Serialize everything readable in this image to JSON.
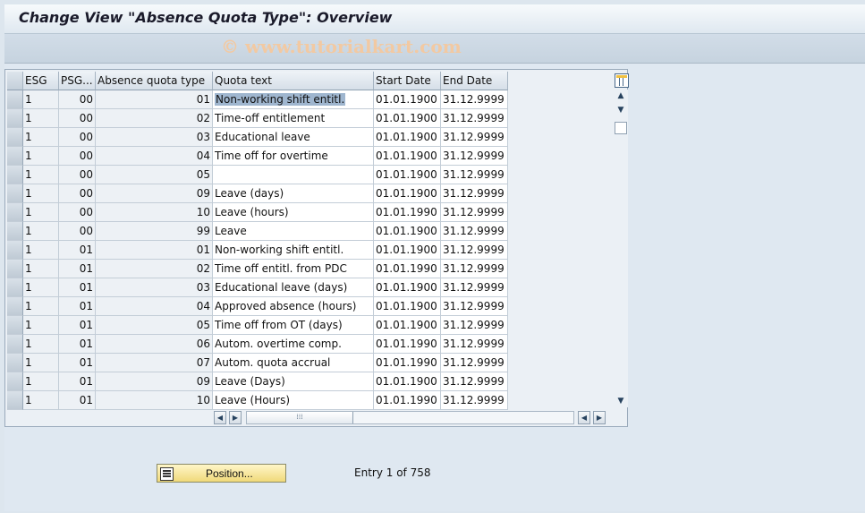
{
  "title": "Change View \"Absence Quota Type\": Overview",
  "watermark": "© www.tutorialkart.com",
  "table": {
    "columns": [
      "ESG",
      "PSG...",
      "Absence quota type",
      "Quota text",
      "Start Date",
      "End Date"
    ],
    "rows": [
      {
        "esg": "1",
        "psg": "00",
        "aqt": "01",
        "qt": "Non-working shift entitl.",
        "sd": "01.01.1900",
        "ed": "31.12.9999"
      },
      {
        "esg": "1",
        "psg": "00",
        "aqt": "02",
        "qt": "Time-off entitlement",
        "sd": "01.01.1900",
        "ed": "31.12.9999"
      },
      {
        "esg": "1",
        "psg": "00",
        "aqt": "03",
        "qt": "Educational leave",
        "sd": "01.01.1900",
        "ed": "31.12.9999"
      },
      {
        "esg": "1",
        "psg": "00",
        "aqt": "04",
        "qt": "Time off for overtime",
        "sd": "01.01.1900",
        "ed": "31.12.9999"
      },
      {
        "esg": "1",
        "psg": "00",
        "aqt": "05",
        "qt": "",
        "sd": "01.01.1900",
        "ed": "31.12.9999"
      },
      {
        "esg": "1",
        "psg": "00",
        "aqt": "09",
        "qt": "Leave (days)",
        "sd": "01.01.1900",
        "ed": "31.12.9999"
      },
      {
        "esg": "1",
        "psg": "00",
        "aqt": "10",
        "qt": "Leave (hours)",
        "sd": "01.01.1990",
        "ed": "31.12.9999"
      },
      {
        "esg": "1",
        "psg": "00",
        "aqt": "99",
        "qt": "Leave",
        "sd": "01.01.1900",
        "ed": "31.12.9999"
      },
      {
        "esg": "1",
        "psg": "01",
        "aqt": "01",
        "qt": "Non-working shift entitl.",
        "sd": "01.01.1900",
        "ed": "31.12.9999"
      },
      {
        "esg": "1",
        "psg": "01",
        "aqt": "02",
        "qt": "Time off entitl. from PDC",
        "sd": "01.01.1990",
        "ed": "31.12.9999"
      },
      {
        "esg": "1",
        "psg": "01",
        "aqt": "03",
        "qt": "Educational leave (days)",
        "sd": "01.01.1900",
        "ed": "31.12.9999"
      },
      {
        "esg": "1",
        "psg": "01",
        "aqt": "04",
        "qt": "Approved absence (hours)",
        "sd": "01.01.1900",
        "ed": "31.12.9999"
      },
      {
        "esg": "1",
        "psg": "01",
        "aqt": "05",
        "qt": "Time off from OT (days)",
        "sd": "01.01.1900",
        "ed": "31.12.9999"
      },
      {
        "esg": "1",
        "psg": "01",
        "aqt": "06",
        "qt": "Autom. overtime comp.",
        "sd": "01.01.1990",
        "ed": "31.12.9999"
      },
      {
        "esg": "1",
        "psg": "01",
        "aqt": "07",
        "qt": "Autom. quota accrual",
        "sd": "01.01.1990",
        "ed": "31.12.9999"
      },
      {
        "esg": "1",
        "psg": "01",
        "aqt": "09",
        "qt": "Leave (Days)",
        "sd": "01.01.1900",
        "ed": "31.12.9999"
      },
      {
        "esg": "1",
        "psg": "01",
        "aqt": "10",
        "qt": "Leave (Hours)",
        "sd": "01.01.1990",
        "ed": "31.12.9999"
      }
    ]
  },
  "position_button": {
    "label": "Position..."
  },
  "entry_info": "Entry 1 of 758"
}
